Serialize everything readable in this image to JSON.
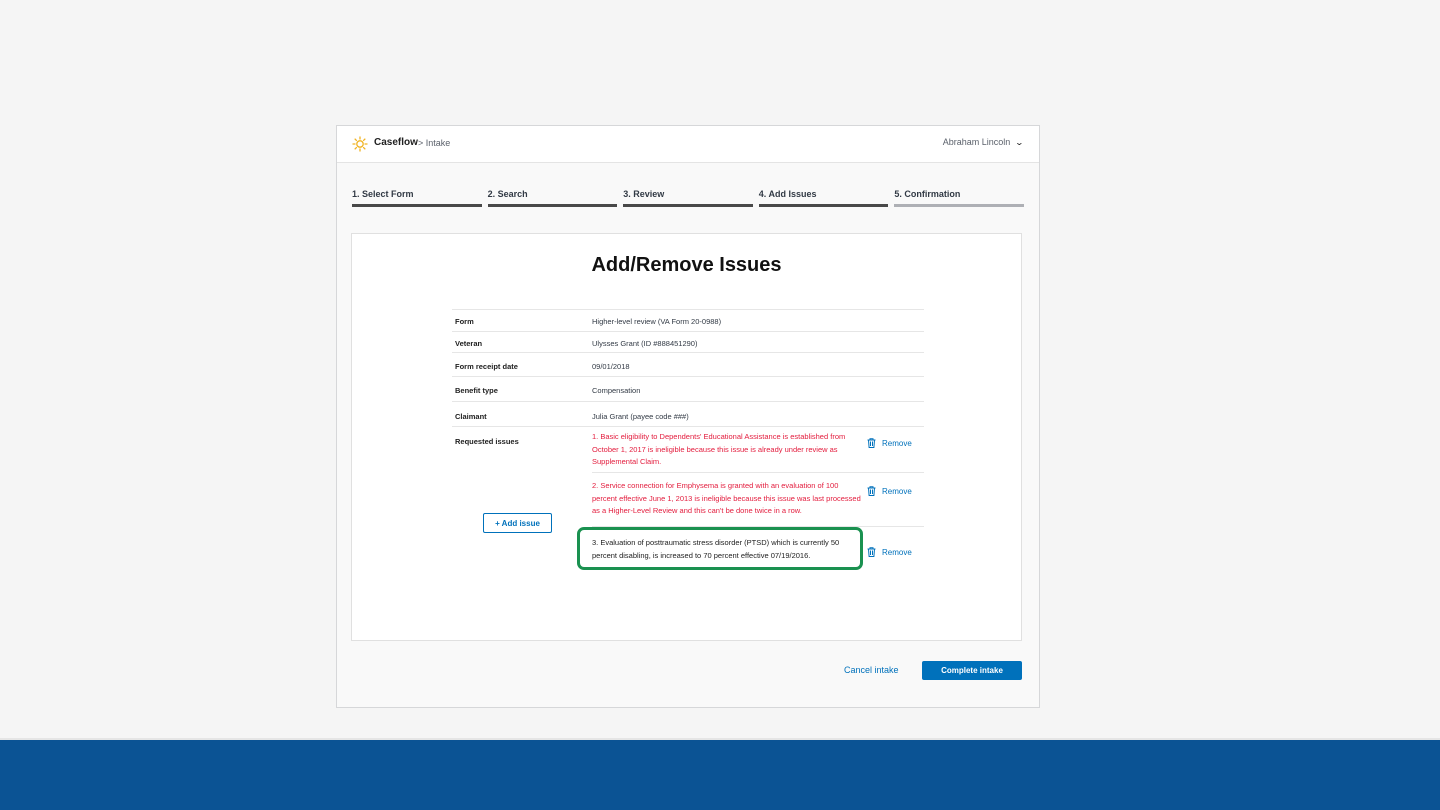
{
  "header": {
    "brand": "Caseflow",
    "breadcrumb": "> Intake",
    "user_name": "Abraham Lincoln",
    "user_menu_icon": "chevron-down-icon"
  },
  "steps": [
    {
      "label": "1. Select Form",
      "state": "complete"
    },
    {
      "label": "2. Search",
      "state": "complete"
    },
    {
      "label": "3. Review",
      "state": "complete"
    },
    {
      "label": "4. Add Issues",
      "state": "current"
    },
    {
      "label": "5. Confirmation",
      "state": "future"
    }
  ],
  "page": {
    "title": "Add/Remove Issues"
  },
  "details": {
    "form_label": "Form",
    "form_value": "Higher-level review (VA Form 20-0988)",
    "veteran_label": "Veteran",
    "veteran_value": "Ulysses Grant (ID #888451290)",
    "receipt_label": "Form receipt date",
    "receipt_value": "09/01/2018",
    "benefit_label": "Benefit type",
    "benefit_value": "Compensation",
    "claimant_label": "Claimant",
    "claimant_value": "Julia Grant (payee code ###)",
    "issues_label": "Requested issues"
  },
  "issues": [
    {
      "text": "1. Basic eligibility to Dependents' Educational Assistance is established from October 1, 2017 is ineligible because this issue is already under review as Supplemental Claim.",
      "status": "ineligible",
      "remove_label": "Remove"
    },
    {
      "text": "2. Service connection for Emphysema is granted with an evaluation of 100 percent effective June 1, 2013 is ineligible because this issue was last processed as a Higher-Level Review and this can't be done twice in a row.",
      "status": "ineligible",
      "remove_label": "Remove"
    },
    {
      "text": "3. Evaluation of posttraumatic stress disorder (PTSD) which is currently 50 percent disabling, is increased to 70 percent effective 07/19/2016.",
      "status": "eligible",
      "remove_label": "Remove"
    }
  ],
  "actions": {
    "add_issue": "+ Add issue",
    "cancel": "Cancel intake",
    "complete": "Complete intake"
  },
  "colors": {
    "primary": "#0071bb",
    "error": "#e31c3d",
    "highlight": "#1a9150",
    "footer_band": "#0b5394"
  }
}
